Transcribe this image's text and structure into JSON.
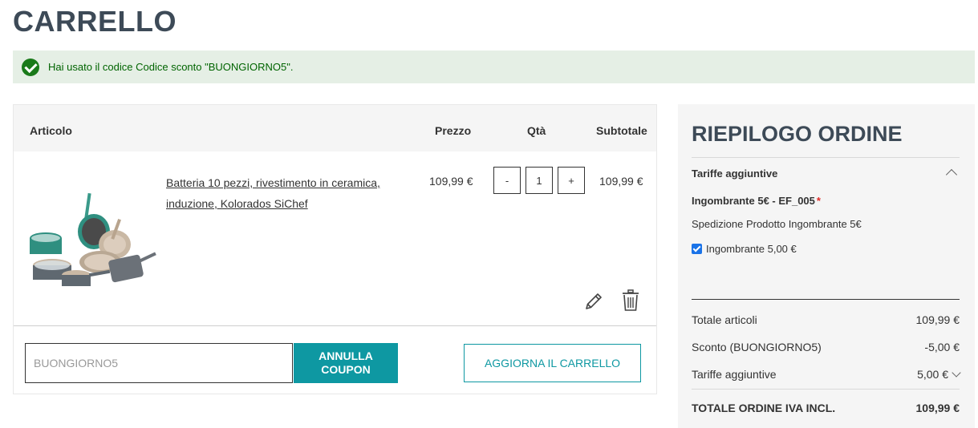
{
  "page": {
    "title": "CARRELLO"
  },
  "message": {
    "text": "Hai usato il codice Codice sconto \"BUONGIORNO5\"."
  },
  "cart": {
    "headers": {
      "article": "Articolo",
      "price": "Prezzo",
      "qty": "Qtà",
      "subtotal": "Subtotale"
    },
    "items": [
      {
        "name": "Batteria 10 pezzi, rivestimento in ceramica, induzione, Kolorados SiChef",
        "price": "109,99 €",
        "qty": "1",
        "qty_minus": "-",
        "qty_plus": "+",
        "subtotal": "109,99 €"
      }
    ],
    "coupon": {
      "value": "BUONGIORNO5",
      "cancel_label": "ANNULLA COUPON"
    },
    "update_label": "AGGIORNA IL CARRELLO"
  },
  "summary": {
    "title": "RIEPILOGO ORDINE",
    "fees_heading": "Tariffe aggiuntive",
    "fee_name": "Ingombrante 5€ - EF_005",
    "fee_required_mark": "*",
    "fee_description": "Spedizione Prodotto Ingombrante 5€",
    "fee_option": "Ingombrante 5,00 €",
    "rows": [
      {
        "label": "Totale articoli",
        "value": "109,99 €"
      },
      {
        "label": "Sconto (BUONGIORNO5)",
        "value": "-5,00 €"
      },
      {
        "label": "Tariffe aggiuntive",
        "value": "5,00 €"
      }
    ],
    "total": {
      "label": "TOTALE ORDINE IVA INCL.",
      "value": "109,99 €"
    }
  },
  "colors": {
    "accent": "#0e98a2",
    "title": "#3d4a57",
    "success_bg": "#e5efe5",
    "success_text": "#006400"
  }
}
